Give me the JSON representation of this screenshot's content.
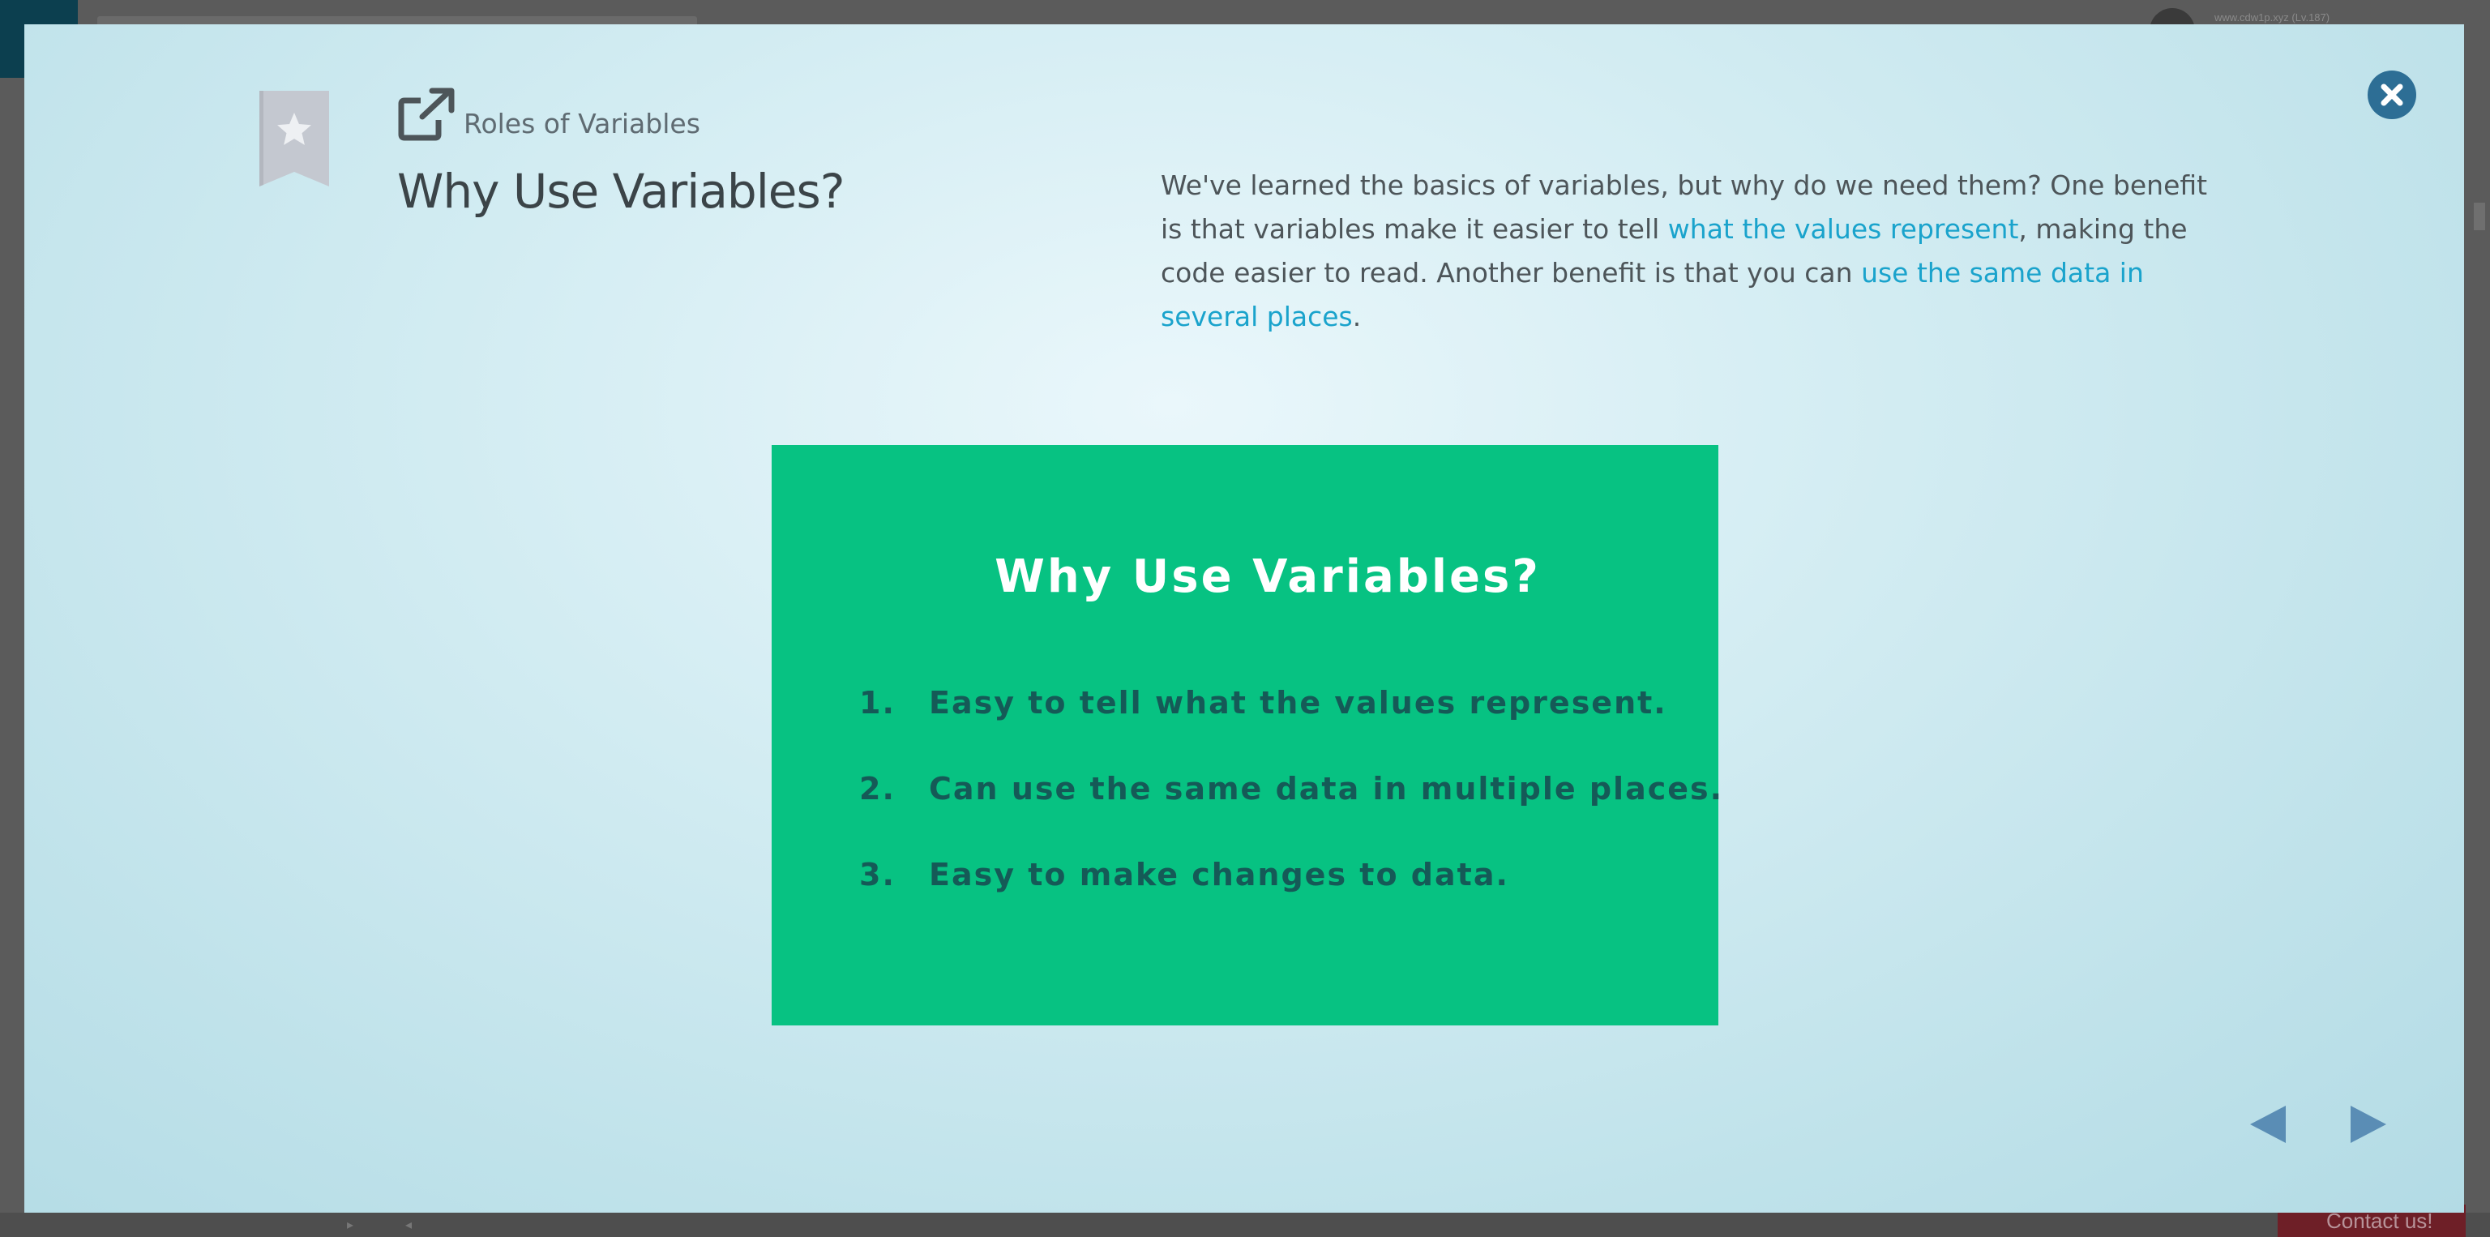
{
  "background": {
    "user_text": "www.cdw1p.xyz (Lv.187)",
    "contact_label": "Contact us!"
  },
  "modal": {
    "lesson_link": "Roles of Variables",
    "title": "Why Use Variables?",
    "description": {
      "part1": "We've learned the basics of variables, but why do we need them? One benefit is that variables make it easier to tell ",
      "link1": "what the values represent",
      "part2": ", making the code easier to read. Another benefit is that you can ",
      "link2": "use the same data in several places",
      "part3": "."
    },
    "image": {
      "title": "Why Use Variables?",
      "items": [
        {
          "num": "1.",
          "text": "Easy to tell what the values represent."
        },
        {
          "num": "2.",
          "text": "Can use the same data in multiple places."
        },
        {
          "num": "3.",
          "text": "Easy to make changes to data."
        }
      ]
    },
    "icons": {
      "bookmark": "bookmark-star-icon",
      "external_link": "external-link-icon",
      "close": "close-icon",
      "prev": "triangle-left-icon",
      "next": "triangle-right-icon"
    },
    "colors": {
      "accent_link": "#1aa3cc",
      "close_button": "#2d6e95",
      "card_green": "#07c282",
      "nav_arrow": "#5a8db5"
    }
  }
}
